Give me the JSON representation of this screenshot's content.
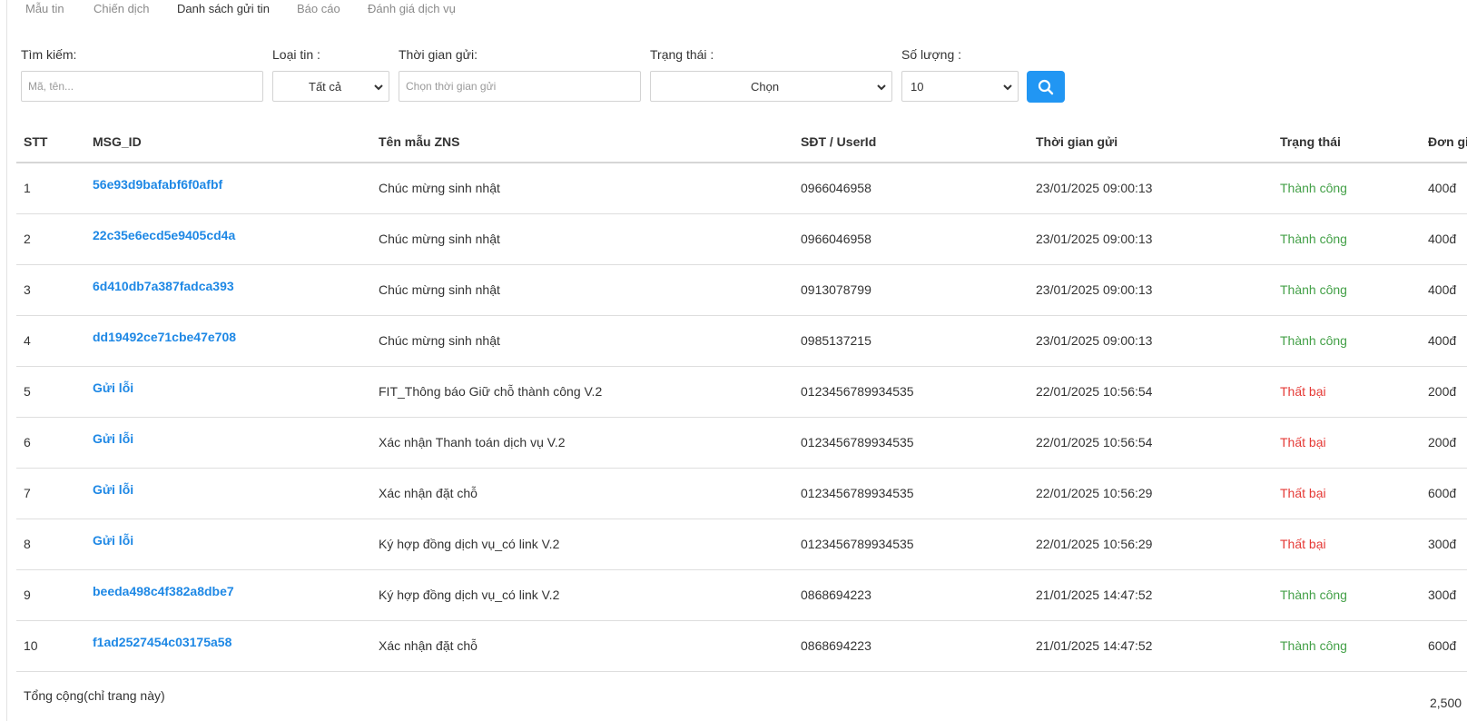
{
  "tabs": [
    {
      "label": "Mẫu tin",
      "active": false
    },
    {
      "label": "Chiến dịch",
      "active": false
    },
    {
      "label": "Danh sách gửi tin",
      "active": true
    },
    {
      "label": "Báo cáo",
      "active": false
    },
    {
      "label": "Đánh giá dịch vụ",
      "active": false
    }
  ],
  "filters": {
    "search": {
      "label": "Tìm kiếm:",
      "placeholder": "Mã, tên..."
    },
    "type": {
      "label": "Loại tin :",
      "value": "Tất cả"
    },
    "time": {
      "label": "Thời gian gửi:",
      "placeholder": "Chọn thời gian gửi"
    },
    "status": {
      "label": "Trạng thái :",
      "value": "Chọn"
    },
    "quantity": {
      "label": "Số lượng :",
      "value": "10"
    },
    "search_button_icon": "search-icon"
  },
  "table": {
    "headers": {
      "stt": "STT",
      "msg_id": "MSG_ID",
      "template": "Tên mẫu ZNS",
      "phone": "SĐT / UserId",
      "time": "Thời gian gửi",
      "status": "Trạng thái",
      "price": "Đơn giá"
    },
    "rows": [
      {
        "stt": "1",
        "msg_id": "56e93d9bafabf6f0afbf",
        "template": "Chúc mừng sinh nhật",
        "phone": "0966046958",
        "time": "23/01/2025 09:00:13",
        "status": "Thành công",
        "ok": true,
        "price": "400đ"
      },
      {
        "stt": "2",
        "msg_id": "22c35e6ecd5e9405cd4a",
        "template": "Chúc mừng sinh nhật",
        "phone": "0966046958",
        "time": "23/01/2025 09:00:13",
        "status": "Thành công",
        "ok": true,
        "price": "400đ"
      },
      {
        "stt": "3",
        "msg_id": "6d410db7a387fadca393",
        "template": "Chúc mừng sinh nhật",
        "phone": "0913078799",
        "time": "23/01/2025 09:00:13",
        "status": "Thành công",
        "ok": true,
        "price": "400đ"
      },
      {
        "stt": "4",
        "msg_id": "dd19492ce71cbe47e708",
        "template": "Chúc mừng sinh nhật",
        "phone": "0985137215",
        "time": "23/01/2025 09:00:13",
        "status": "Thành công",
        "ok": true,
        "price": "400đ"
      },
      {
        "stt": "5",
        "msg_id": "Gửi lỗi",
        "template": "FIT_Thông báo Giữ chỗ thành công V.2",
        "phone": "0123456789934535",
        "time": "22/01/2025 10:56:54",
        "status": "Thất bại",
        "ok": false,
        "price": "200đ"
      },
      {
        "stt": "6",
        "msg_id": "Gửi lỗi",
        "template": "Xác nhận Thanh toán dịch vụ V.2",
        "phone": "0123456789934535",
        "time": "22/01/2025 10:56:54",
        "status": "Thất bại",
        "ok": false,
        "price": "200đ"
      },
      {
        "stt": "7",
        "msg_id": "Gửi lỗi",
        "template": "Xác nhận đặt chỗ",
        "phone": "0123456789934535",
        "time": "22/01/2025 10:56:29",
        "status": "Thất bại",
        "ok": false,
        "price": "600đ"
      },
      {
        "stt": "8",
        "msg_id": "Gửi lỗi",
        "template": "Ký hợp đồng dịch vụ_có link V.2",
        "phone": "0123456789934535",
        "time": "22/01/2025 10:56:29",
        "status": "Thất bại",
        "ok": false,
        "price": "300đ"
      },
      {
        "stt": "9",
        "msg_id": "beeda498c4f382a8dbe7",
        "template": "Ký hợp đồng dịch vụ_có link V.2",
        "phone": "0868694223",
        "time": "21/01/2025 14:47:52",
        "status": "Thành công",
        "ok": true,
        "price": "300đ"
      },
      {
        "stt": "10",
        "msg_id": "f1ad2527454c03175a58",
        "template": "Xác nhận đặt chỗ",
        "phone": "0868694223",
        "time": "21/01/2025 14:47:52",
        "status": "Thành công",
        "ok": true,
        "price": "600đ"
      }
    ],
    "total_label": "Tổng cộng(chỉ trang này)",
    "total_value": "2,500"
  },
  "colors": {
    "accent": "#2196f3",
    "link": "#1e88e5",
    "success": "#43a047",
    "failure": "#e53935"
  }
}
